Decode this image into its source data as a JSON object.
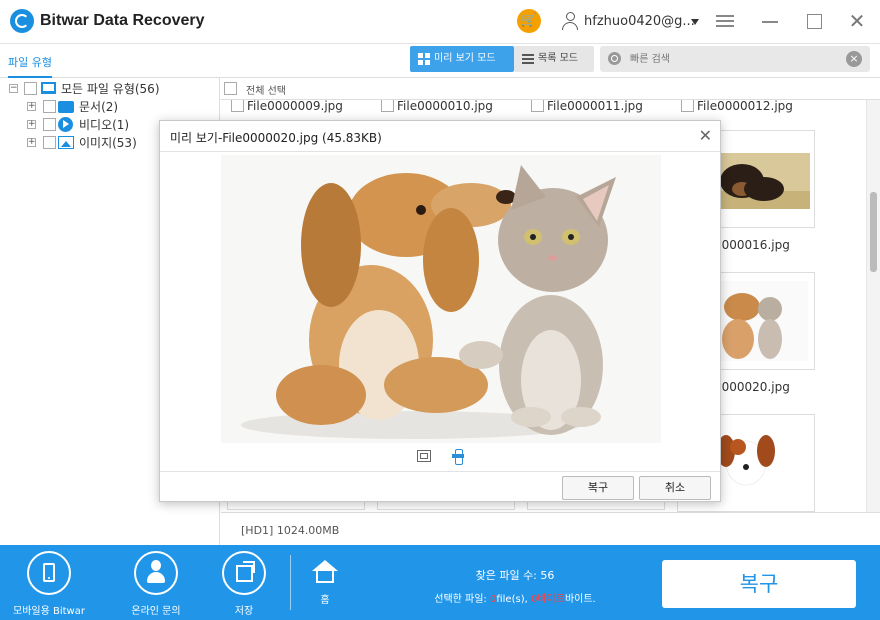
{
  "app": {
    "title": "Bitwar Data Recovery",
    "user": "hfzhuo0420@g..."
  },
  "toolbar": {
    "tab_file_type": "파일 유형",
    "preview_mode": "미리 보기 모드",
    "list_mode": "목록 모드",
    "search_placeholder": "빠른 검색"
  },
  "tree": {
    "root": "모든 파일 유형(56)",
    "items": [
      {
        "label": "문서(2)",
        "icon": "folder-icon"
      },
      {
        "label": "비디오(1)",
        "icon": "video-icon"
      },
      {
        "label": "이미지(53)",
        "icon": "image-icon"
      }
    ]
  },
  "main": {
    "select_all": "전체 선택",
    "row1": [
      "File0000009.jpg",
      "File0000010.jpg",
      "File0000011.jpg",
      "File0000012.jpg"
    ],
    "row2_visible": "0000016.jpg",
    "row3_visible": "0000020.jpg",
    "disk_info": "[HD1] 1024.00MB"
  },
  "dialog": {
    "title": "미리 보기-File0000020.jpg (45.83KB)",
    "recover": "복구",
    "cancel": "취소"
  },
  "bottom": {
    "mobile": "모바일용 Bitwar",
    "online": "온라인 문의",
    "save": "저장",
    "home": "홈",
    "found_files": "찾은 파일 수: 56",
    "selected_prefix": "선택한 파일: ",
    "selected_files_count": "0",
    "selected_files_suffix": "file(s), ",
    "selected_bytes_count": "0",
    "selected_bytes_unit": "바이트",
    "selected_bytes_suffix": "바이트.",
    "recover_big": "복구"
  },
  "colors": {
    "accent": "#2196e9",
    "cart": "#f4a100",
    "highlight": "#ff3d3d"
  }
}
